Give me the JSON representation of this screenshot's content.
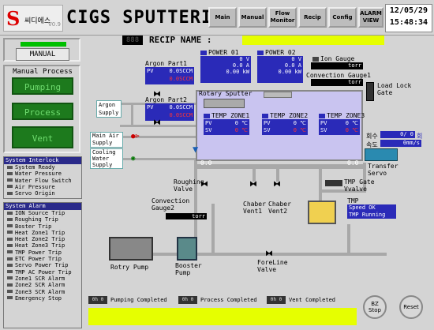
{
  "header": {
    "logo_mark": "S",
    "logo_text": "씨디에스",
    "version": "V0.9",
    "title": "CIGS SPUTTERING",
    "nav": [
      {
        "label": "Main"
      },
      {
        "label": "Manual"
      },
      {
        "label": "Flow Monitor"
      },
      {
        "label": "Recip"
      },
      {
        "label": "Config"
      },
      {
        "label": "ALARM VIEW"
      }
    ],
    "date": "12/05/29",
    "time": "15:48:34"
  },
  "recipe": {
    "seg": "888",
    "label": "RECIP NAME :",
    "value": ""
  },
  "left": {
    "mode_button": "MANUAL",
    "process_title": "Manual Process",
    "buttons": [
      "Pumping",
      "Process",
      "Vent"
    ],
    "interlock_title": "System Interlock",
    "interlocks": [
      "System Ready",
      "Water Pressure",
      "Water Flow Switch",
      "Air Pressure",
      "Servo Origin"
    ],
    "alarm_title": "System Alarm",
    "alarms": [
      "ION Source Trip",
      "Roughing Trip",
      "Boster Trip",
      "Heat Zone1 Trip",
      "Heat Zone2 Trip",
      "Heat Zone3 Trip",
      "TMP Power Trip",
      "ETC Power Trip",
      "Servo Power Trip",
      "TMP AC Power Trip",
      "Zone1 SCR Alarm",
      "Zone2 SCR Alarm",
      "Zone3 SCR Alarm",
      "Emergency Stop"
    ]
  },
  "diagram": {
    "argon1": {
      "label": "Argon Part1",
      "pv_label": "PV",
      "pv": "0.0SCCM",
      "sv": "0.0SCCM"
    },
    "argon2": {
      "label": "Argon Part2",
      "pv_label": "PV",
      "pv": "0.0SCCM",
      "sv": "0.0SCCM"
    },
    "argon_supply": "Argon Supply",
    "main_air": "Main Air Supply",
    "cooling_water": "Cooling Water Supply",
    "power1": {
      "label": "POWER 01",
      "v": "0 V",
      "a": "0.0 A",
      "w": "0.00 kW"
    },
    "power2": {
      "label": "POWER 02",
      "v": "0 V",
      "a": "0.0 A",
      "w": "0.00 kW"
    },
    "ion_gauge": {
      "label": "Ion Gauge",
      "unit": "torr"
    },
    "conv_gauge1": {
      "label": "Convection Gauge1",
      "unit": "torr"
    },
    "load_lock": "Load Lock Gate",
    "rotary_sputter": "Rotary Sputter",
    "zones": [
      {
        "label": "TEMP ZONE1",
        "pv_label": "PV",
        "pv": "0 ℃",
        "sv_label": "SV",
        "sv": "0 ℃"
      },
      {
        "label": "TEMP ZONE2",
        "pv_label": "PV",
        "pv": "0 ℃",
        "sv_label": "SV",
        "sv": "0 ℃"
      },
      {
        "label": "TEMP ZONE3",
        "pv_label": "PV",
        "pv": "0 ℃",
        "sv_label": "SV",
        "sv": "0 ℃"
      }
    ],
    "chamber_left_val": "0.0",
    "chamber_right_val": "0.0",
    "count_label": "회수",
    "count_value": "0/ 0",
    "count_unit": "회",
    "speed_label": "속도",
    "speed_unit": "0mm/s",
    "transfer_servo": "Transfer Servo",
    "roughing_valve": "Roughing Valve",
    "conv_gauge2": {
      "label": "Convection Gauge2",
      "unit": "torr"
    },
    "chamber_vent1": "Chaber Vent1",
    "chamber_vent2": "Chaber Vent2",
    "tmp_gate": "TMP Gate Vvalve",
    "tmp_label": "TMP",
    "tmp_speed": "Speed OK",
    "tmp_running": "TMP Running",
    "rotary_pump": "Rotry Pump",
    "booster_pump": "Booster Pump",
    "foreline_valve": "ForeLine Valve"
  },
  "status": {
    "pumping": {
      "seg": "0h 0",
      "label": "Pumping Completed"
    },
    "process": {
      "seg": "0h 0",
      "label": "Process Completed"
    },
    "vent": {
      "seg": "0h 0",
      "label": "Vent Completed"
    }
  },
  "buttons": {
    "bz_stop": "BZ Stop",
    "reset": "Reset"
  },
  "colors": {
    "accent_blue": "#2a2ab8",
    "green": "#1d7a1d",
    "yellow": "#e6ff00",
    "chamber": "#c9c4f0"
  }
}
